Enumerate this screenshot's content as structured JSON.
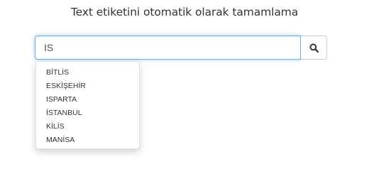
{
  "page": {
    "title": "Text etiketini otomatik olarak tamamlama"
  },
  "search": {
    "value": "IS",
    "button_icon": "search-icon"
  },
  "suggestions": [
    "BİTLİS",
    "ESKİŞEHİR",
    "ISPARTA",
    "İSTANBUL",
    "KİLİS",
    "MANİSA"
  ],
  "colors": {
    "focus_border": "#66afe9",
    "text": "#333333"
  }
}
